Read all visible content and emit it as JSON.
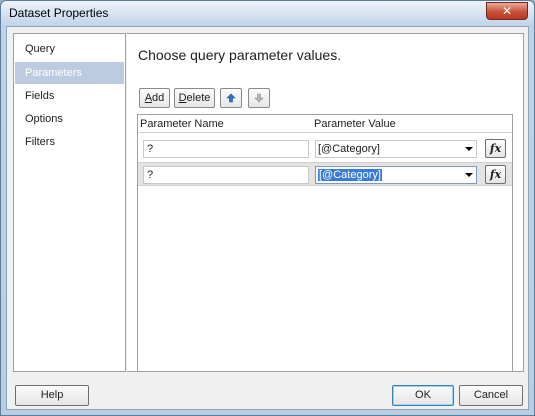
{
  "window": {
    "title": "Dataset Properties",
    "close_glyph": "✕"
  },
  "nav": {
    "items": [
      {
        "label": "Query",
        "selected": false
      },
      {
        "label": "Parameters",
        "selected": true
      },
      {
        "label": "Fields",
        "selected": false
      },
      {
        "label": "Options",
        "selected": false
      },
      {
        "label": "Filters",
        "selected": false
      }
    ]
  },
  "main": {
    "heading": "Choose query parameter values.",
    "toolbar": {
      "add_label": "Add",
      "add_accel": "A",
      "delete_label": "Delete",
      "delete_accel": "D",
      "move_up_icon": "arrow-up-icon",
      "move_down_icon": "arrow-down-icon"
    },
    "grid": {
      "columns": [
        "Parameter Name",
        "Parameter Value"
      ],
      "rows": [
        {
          "name": "?",
          "value": "[@Category]",
          "selected": false
        },
        {
          "name": "?",
          "value": "[@Category]",
          "selected": true
        }
      ],
      "expression_button": "fx"
    }
  },
  "footer": {
    "help_label": "Help",
    "ok_label": "OK",
    "cancel_label": "Cancel"
  },
  "colors": {
    "accent": "#3a7ad8",
    "nav_selected": "#bccbe0"
  }
}
